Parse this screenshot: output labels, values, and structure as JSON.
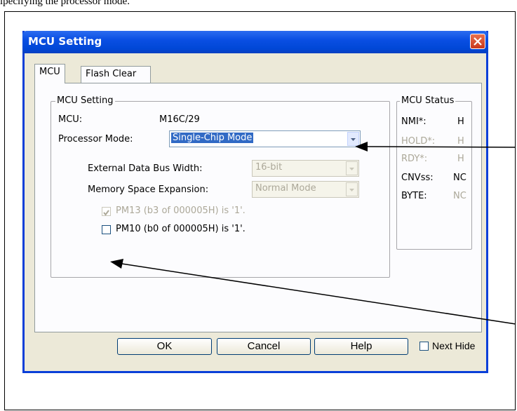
{
  "doc": {
    "top_text": "ıpecifying the processor mode."
  },
  "dialog": {
    "title": "MCU Setting",
    "tabs": [
      "MCU",
      "Flash Clear"
    ],
    "mcu_group": {
      "legend": "MCU Setting",
      "mcu_label": "MCU:",
      "mcu_value": "M16C/29",
      "processor_mode_label": "Processor Mode:",
      "processor_mode_value": "Single-Chip Mode",
      "ext_bus_label": "External Data Bus Width:",
      "ext_bus_value": "16-bit",
      "mem_exp_label": "Memory Space Expansion:",
      "mem_exp_value": "Normal Mode",
      "pm13_label": "PM13 (b3 of 000005H) is '1'.",
      "pm10_label": "PM10 (b0 of 000005H) is '1'."
    },
    "status_group": {
      "legend": "MCU Status",
      "rows": [
        {
          "label": "NMI*:",
          "value": "H"
        },
        {
          "label": "HOLD*:",
          "value": "H"
        },
        {
          "label": "RDY*:",
          "value": "H"
        },
        {
          "label": "CNVss:",
          "value": "NC"
        },
        {
          "label": "BYTE:",
          "value": "NC"
        }
      ]
    },
    "buttons": {
      "ok": "OK",
      "cancel": "Cancel",
      "help": "Help",
      "next_hide": "Next Hide"
    }
  }
}
